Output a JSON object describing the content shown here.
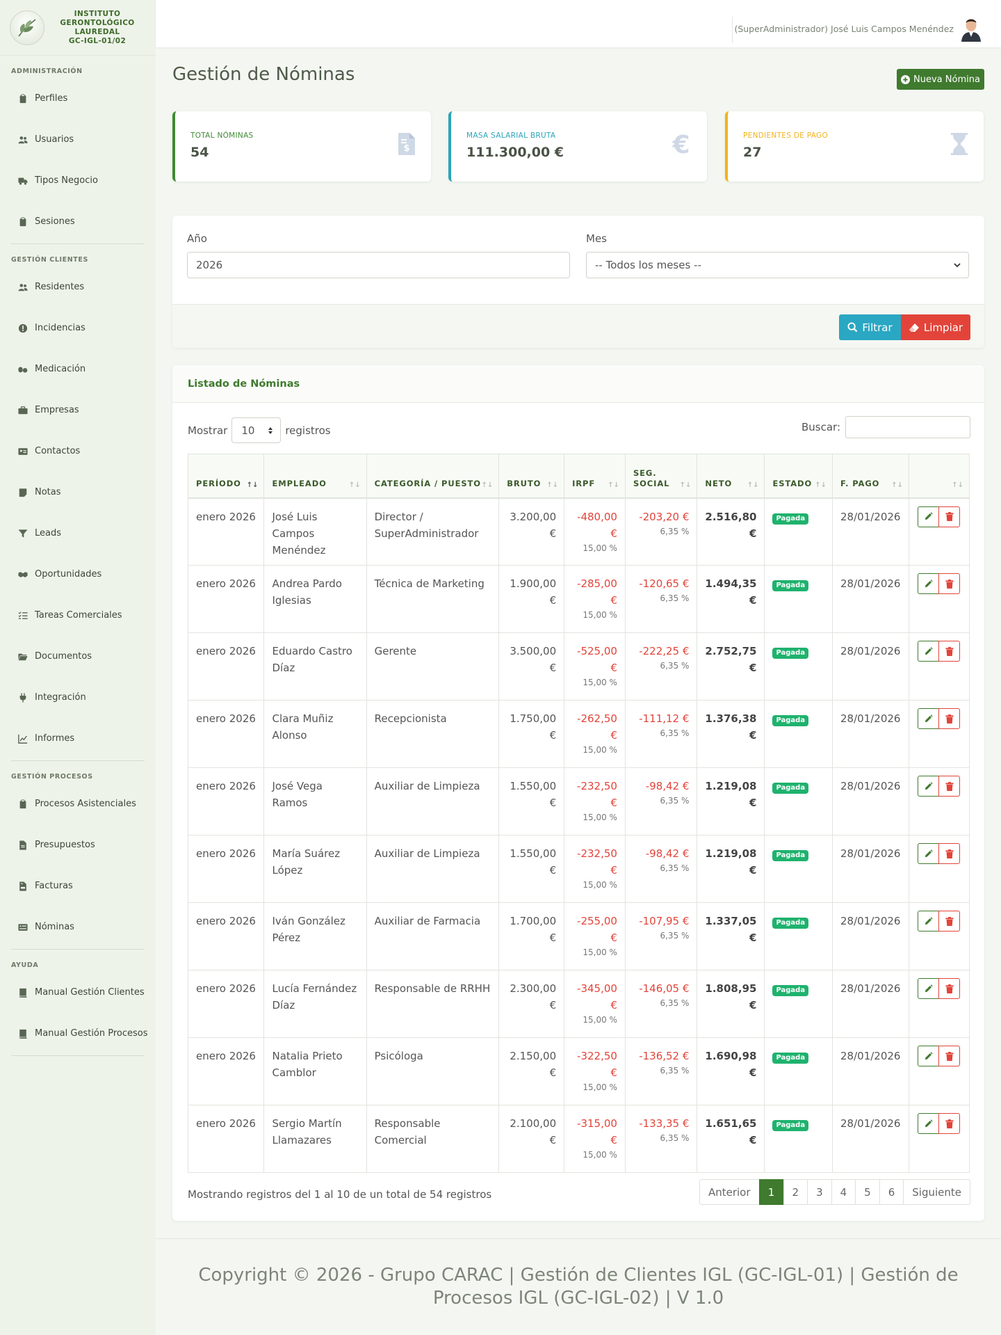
{
  "brand": {
    "lines": [
      "INSTITUTO",
      "GERONTOLÓGICO",
      "LAUREDAL",
      "GC-IGL-01/02"
    ]
  },
  "sidebar": {
    "sections": [
      {
        "title": "ADMINISTRACIÓN",
        "items": [
          {
            "label": "Perfiles",
            "icon": "clipboard-icon"
          },
          {
            "label": "Usuarios",
            "icon": "users-icon"
          },
          {
            "label": "Tipos Negocio",
            "icon": "truck-icon"
          },
          {
            "label": "Sesiones",
            "icon": "clipboard-icon"
          }
        ]
      },
      {
        "title": "GESTIÓN CLIENTES",
        "items": [
          {
            "label": "Residentes",
            "icon": "users-icon"
          },
          {
            "label": "Incidencias",
            "icon": "alert-circle-icon"
          },
          {
            "label": "Medicación",
            "icon": "pills-icon"
          },
          {
            "label": "Empresas",
            "icon": "briefcase-icon"
          },
          {
            "label": "Contactos",
            "icon": "id-card-icon"
          },
          {
            "label": "Notas",
            "icon": "note-icon"
          },
          {
            "label": "Leads",
            "icon": "funnel-icon"
          },
          {
            "label": "Oportunidades",
            "icon": "handshake-icon"
          },
          {
            "label": "Tareas Comerciales",
            "icon": "list-check-icon"
          },
          {
            "label": "Documentos",
            "icon": "folder-open-icon"
          },
          {
            "label": "Integración",
            "icon": "plug-icon"
          },
          {
            "label": "Informes",
            "icon": "line-chart-icon"
          }
        ]
      },
      {
        "title": "GESTIÓN PROCESOS",
        "items": [
          {
            "label": "Procesos Asistenciales",
            "icon": "clipboard-icon"
          },
          {
            "label": "Presupuestos",
            "icon": "file-icon"
          },
          {
            "label": "Facturas",
            "icon": "invoice-icon"
          },
          {
            "label": "Nóminas",
            "icon": "money-card-icon"
          }
        ]
      },
      {
        "title": "AYUDA",
        "items": [
          {
            "label": "Manual Gestión Clientes",
            "icon": "book-icon"
          },
          {
            "label": "Manual Gestión Procesos",
            "icon": "book-icon"
          }
        ]
      }
    ]
  },
  "topbar": {
    "user": "(SuperAdministrador) José Luis Campos Menéndez"
  },
  "main": {
    "title": "Gestión de Nóminas",
    "new_button": "Nueva Nómina"
  },
  "stats": [
    {
      "label": "TOTAL NÓMINAS",
      "value": "54",
      "color": "#3f8a34",
      "icon": "file-dollar-icon"
    },
    {
      "label": "MASA SALARIAL BRUTA",
      "value": "111.300,00 €",
      "color": "#2ba4b8",
      "icon": "euro-icon"
    },
    {
      "label": "PENDIENTES DE PAGO",
      "value": "27",
      "color": "#f1b31c",
      "icon": "hourglass-icon"
    }
  ],
  "filters": {
    "year_label": "Año",
    "year_value": "2026",
    "month_label": "Mes",
    "month_value": "-- Todos los meses --",
    "filter_button": "Filtrar",
    "clear_button": "Limpiar"
  },
  "list": {
    "title": "Listado de Nóminas",
    "show_label": "Mostrar",
    "show_value": "10",
    "records_label": "registros",
    "search_label": "Buscar:",
    "columns": [
      "PERÍODO",
      "EMPLEADO",
      "CATEGORÍA / PUESTO",
      "BRUTO",
      "IRPF",
      "SEG. SOCIAL",
      "NETO",
      "ESTADO",
      "F. PAGO",
      ""
    ],
    "rows": [
      {
        "periodo": "enero 2026",
        "empleado": "José Luis Campos Menéndez",
        "categoria": "Director / SuperAdministrador",
        "bruto": "3.200,00 €",
        "irpf": "-480,00 €",
        "irpf_pct": "15,00 %",
        "ss": "-203,20 €",
        "ss_pct": "6,35 %",
        "neto": "2.516,80 €",
        "estado": "Pagada",
        "fpago": "28/01/2026"
      },
      {
        "periodo": "enero 2026",
        "empleado": "Andrea Pardo Iglesias",
        "categoria": "Técnica de Marketing",
        "bruto": "1.900,00 €",
        "irpf": "-285,00 €",
        "irpf_pct": "15,00 %",
        "ss": "-120,65 €",
        "ss_pct": "6,35 %",
        "neto": "1.494,35 €",
        "estado": "Pagada",
        "fpago": "28/01/2026"
      },
      {
        "periodo": "enero 2026",
        "empleado": "Eduardo Castro Díaz",
        "categoria": "Gerente",
        "bruto": "3.500,00 €",
        "irpf": "-525,00 €",
        "irpf_pct": "15,00 %",
        "ss": "-222,25 €",
        "ss_pct": "6,35 %",
        "neto": "2.752,75 €",
        "estado": "Pagada",
        "fpago": "28/01/2026"
      },
      {
        "periodo": "enero 2026",
        "empleado": "Clara Muñiz Alonso",
        "categoria": "Recepcionista",
        "bruto": "1.750,00 €",
        "irpf": "-262,50 €",
        "irpf_pct": "15,00 %",
        "ss": "-111,12 €",
        "ss_pct": "6,35 %",
        "neto": "1.376,38 €",
        "estado": "Pagada",
        "fpago": "28/01/2026"
      },
      {
        "periodo": "enero 2026",
        "empleado": "José Vega Ramos",
        "categoria": "Auxiliar de Limpieza",
        "bruto": "1.550,00 €",
        "irpf": "-232,50 €",
        "irpf_pct": "15,00 %",
        "ss": "-98,42 €",
        "ss_pct": "6,35 %",
        "neto": "1.219,08 €",
        "estado": "Pagada",
        "fpago": "28/01/2026"
      },
      {
        "periodo": "enero 2026",
        "empleado": "María Suárez López",
        "categoria": "Auxiliar de Limpieza",
        "bruto": "1.550,00 €",
        "irpf": "-232,50 €",
        "irpf_pct": "15,00 %",
        "ss": "-98,42 €",
        "ss_pct": "6,35 %",
        "neto": "1.219,08 €",
        "estado": "Pagada",
        "fpago": "28/01/2026"
      },
      {
        "periodo": "enero 2026",
        "empleado": "Iván González Pérez",
        "categoria": "Auxiliar de Farmacia",
        "bruto": "1.700,00 €",
        "irpf": "-255,00 €",
        "irpf_pct": "15,00 %",
        "ss": "-107,95 €",
        "ss_pct": "6,35 %",
        "neto": "1.337,05 €",
        "estado": "Pagada",
        "fpago": "28/01/2026"
      },
      {
        "periodo": "enero 2026",
        "empleado": "Lucía Fernández Díaz",
        "categoria": "Responsable de RRHH",
        "bruto": "2.300,00 €",
        "irpf": "-345,00 €",
        "irpf_pct": "15,00 %",
        "ss": "-146,05 €",
        "ss_pct": "6,35 %",
        "neto": "1.808,95 €",
        "estado": "Pagada",
        "fpago": "28/01/2026"
      },
      {
        "periodo": "enero 2026",
        "empleado": "Natalia Prieto Camblor",
        "categoria": "Psicóloga",
        "bruto": "2.150,00 €",
        "irpf": "-322,50 €",
        "irpf_pct": "15,00 %",
        "ss": "-136,52 €",
        "ss_pct": "6,35 %",
        "neto": "1.690,98 €",
        "estado": "Pagada",
        "fpago": "28/01/2026"
      },
      {
        "periodo": "enero 2026",
        "empleado": "Sergio Martín Llamazares",
        "categoria": "Responsable Comercial",
        "bruto": "2.100,00 €",
        "irpf": "-315,00 €",
        "irpf_pct": "15,00 %",
        "ss": "-133,35 €",
        "ss_pct": "6,35 %",
        "neto": "1.651,65 €",
        "estado": "Pagada",
        "fpago": "28/01/2026"
      }
    ],
    "info": "Mostrando registros del 1 al 10 de un total de 54 registros",
    "pagination": {
      "prev": "Anterior",
      "pages": [
        "1",
        "2",
        "3",
        "4",
        "5",
        "6"
      ],
      "active": "1",
      "next": "Siguiente"
    }
  },
  "footer": {
    "text": "Copyright © 2026 - Grupo CARAC | Gestión de Clientes IGL (GC-IGL-01) | Gestión de Procesos IGL (GC-IGL-02) | V 1.0"
  }
}
